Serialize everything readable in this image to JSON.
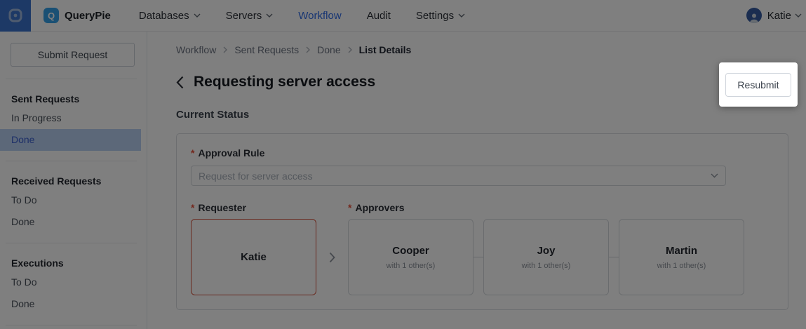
{
  "nav": {
    "brand": "QueryPie",
    "brand_initial": "Q",
    "items": [
      {
        "label": "Databases",
        "has_dropdown": true,
        "active": false
      },
      {
        "label": "Servers",
        "has_dropdown": true,
        "active": false
      },
      {
        "label": "Workflow",
        "has_dropdown": false,
        "active": true
      },
      {
        "label": "Audit",
        "has_dropdown": false,
        "active": false
      },
      {
        "label": "Settings",
        "has_dropdown": true,
        "active": false
      }
    ],
    "user": {
      "name": "Katie"
    }
  },
  "sidebar": {
    "submit_button": "Submit Request",
    "sections": [
      {
        "title": "Sent Requests",
        "items": [
          {
            "label": "In Progress",
            "selected": false
          },
          {
            "label": "Done",
            "selected": true
          }
        ]
      },
      {
        "title": "Received Requests",
        "items": [
          {
            "label": "To Do",
            "selected": false
          },
          {
            "label": "Done",
            "selected": false
          }
        ]
      },
      {
        "title": "Executions",
        "items": [
          {
            "label": "To Do",
            "selected": false
          },
          {
            "label": "Done",
            "selected": false
          }
        ]
      }
    ]
  },
  "breadcrumb": [
    "Workflow",
    "Sent Requests",
    "Done",
    "List Details"
  ],
  "page": {
    "title": "Requesting server access",
    "resubmit_label": "Resubmit",
    "status_heading": "Current Status"
  },
  "form": {
    "required_mark": "*",
    "approval_rule": {
      "label": "Approval Rule",
      "value": "Request for server access"
    },
    "requester": {
      "label": "Requester",
      "name": "Katie"
    },
    "approvers": {
      "label": "Approvers",
      "steps": [
        {
          "name": "Cooper",
          "sub": "with 1 other(s)"
        },
        {
          "name": "Joy",
          "sub": "with 1 other(s)"
        },
        {
          "name": "Martin",
          "sub": "with 1 other(s)"
        }
      ]
    }
  },
  "colors": {
    "brand_strip_blue": "#3a72cc",
    "logo_badge_blue": "#35a0e8",
    "active_link_blue": "#2e6be6",
    "sidebar_selected_bg": "#b8d0f2",
    "sidebar_selected_text": "#3a5fd0",
    "required_red": "#e8503a",
    "requester_border_red": "#d4543f",
    "overlay": "rgba(0,0,0,0.5)"
  }
}
